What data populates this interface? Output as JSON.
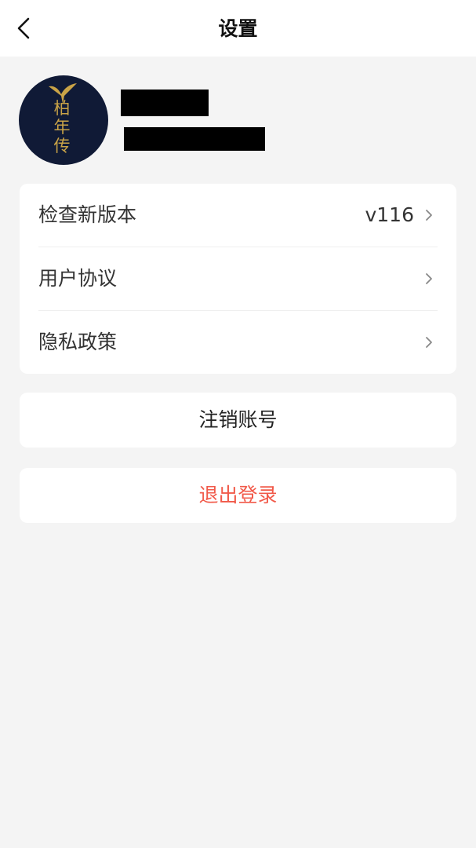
{
  "header": {
    "title": "设置",
    "back_icon": "back-arrow-icon"
  },
  "profile": {
    "avatar_brand_text": "柏年传"
  },
  "menu": {
    "items": [
      {
        "label": "检查新版本",
        "value": "v116"
      },
      {
        "label": "用户协议",
        "value": ""
      },
      {
        "label": "隐私政策",
        "value": ""
      }
    ]
  },
  "actions": {
    "deactivate_label": "注销账号",
    "logout_label": "退出登录"
  },
  "colors": {
    "background": "#f4f4f4",
    "card": "#ffffff",
    "logout_text": "#f15a4a",
    "avatar_bg": "#101a36",
    "avatar_gold": "#c9a347"
  }
}
